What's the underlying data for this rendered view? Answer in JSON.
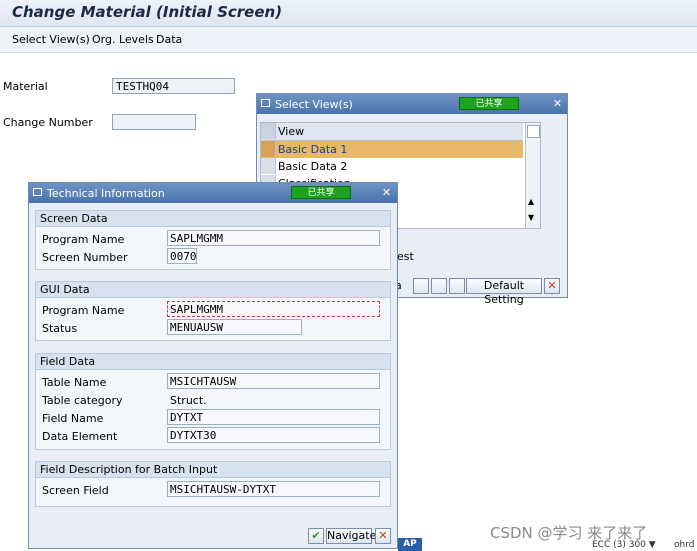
{
  "title": "Change Material (Initial Screen)",
  "menu": [
    "Select View(s)",
    "Org. Levels",
    "Data"
  ],
  "main": {
    "material_label": "Material",
    "material_value": "TESTHQ04",
    "change_number_label": "Change Number",
    "change_number_value": ""
  },
  "select_views": {
    "title": "Select View(s)",
    "badge": "已共享",
    "column": "View",
    "items": [
      "Basic Data 1",
      "Basic Data 2",
      "Classification"
    ],
    "partial_text": "est",
    "toolbar_partial": "a",
    "default_button": "Default Setting"
  },
  "tech": {
    "title": "Technical Information",
    "badge": "已共享",
    "groups": {
      "screen": {
        "title": "Screen Data",
        "program_label": "Program Name",
        "program_value": "SAPLMGMM",
        "screen_label": "Screen Number",
        "screen_value": "0070"
      },
      "gui": {
        "title": "GUI Data",
        "program_label": "Program Name",
        "program_value": "SAPLMGMM",
        "status_label": "Status",
        "status_value": "MENUAUSW"
      },
      "field": {
        "title": "Field Data",
        "table_label": "Table Name",
        "table_value": "MSICHTAUSW",
        "category_label": "Table category",
        "category_value": "Struct.",
        "fieldname_label": "Field Name",
        "fieldname_value": "DYTXT",
        "element_label": "Data Element",
        "element_value": "DYTXT30"
      },
      "batch": {
        "title": "Field Description for Batch Input",
        "screen_field_label": "Screen Field",
        "screen_field_value": "MSICHTAUSW-DYTXT"
      }
    },
    "navigate_label": "Navigate"
  },
  "statusbar": {
    "sap": "AP",
    "system": "ECC (3) 300 ▼",
    "host": "ohrd"
  },
  "watermark": "CSDN @学习 来了来了",
  "colors": {
    "title_blue": "#4a73ab",
    "badge_green": "#1fa31f",
    "selected_row": "#e8b86a",
    "ok_green": "#2e9a2e",
    "cancel_red": "#c0392b"
  }
}
